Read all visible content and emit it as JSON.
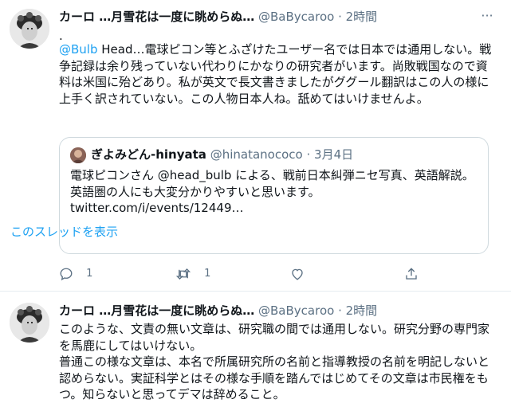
{
  "tweets": [
    {
      "name": "カーロ …月雪花は一度に眺めらぬ…",
      "handle": "@BaBycaroo",
      "sep": "·",
      "time": "2時間",
      "more_icon": "···",
      "dot": ".",
      "mention": "@Bulb",
      "text": " Head…電球ピコン等とふざけたユーザー名では日本では通用しない。戦争記録は余り残っていない代わりにかなりの研究者がいます。尚敗戦国なので資料は米国に殆どあり。私が英文で長文書きましたがググール翻訳はこの人の様に上手く訳されていない。この人物日本人ね。舐めてはいけませんよ。",
      "quote": {
        "name": "ぎよみどん-hinyata",
        "handle": "@hinatanococo",
        "sep": "·",
        "time": "3月4日",
        "text": "電球ピコンさん @head_bulb による、戦前日本糾弾ニセ写真、英語解説。英語圏の人にも大変分かりやすいと思います。",
        "link": "twitter.com/i/events/12449…"
      },
      "show_thread": "このスレッドを表示",
      "reply_count": "1",
      "retweet_count": "1"
    },
    {
      "name": "カーロ …月雪花は一度に眺めらぬ…",
      "handle": "@BaBycaroo",
      "sep": "·",
      "time": "2時間",
      "text": "このような、文責の無い文章は、研究職の間では通用しない。研究分野の専門家を馬鹿にしてはいけない。\n普通この様な文章は、本名で所属研究所の名前と指導教授の名前を明記しないと認めらない。実証科学とはその様な手順を踏んではじめてその文章は市民権をもつ。知らないと思ってデマは辞めること。"
    }
  ],
  "colors": {
    "accent": "#1da1f2",
    "secondary": "#5b7083",
    "border": "#cfd9de"
  }
}
